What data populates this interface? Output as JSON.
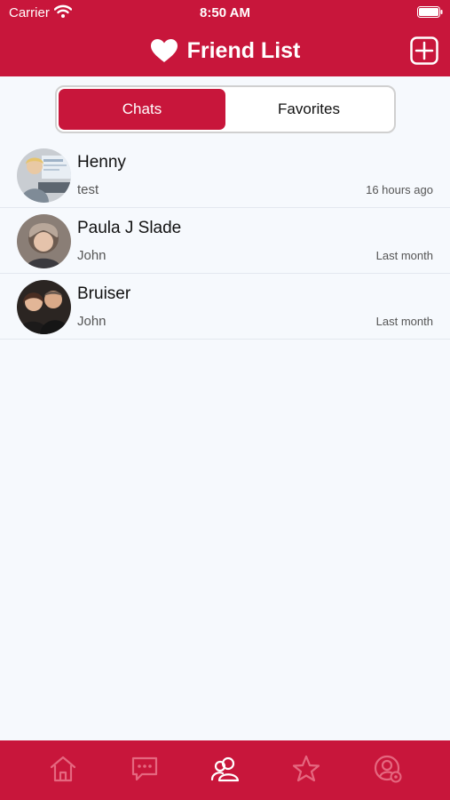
{
  "status_bar": {
    "carrier": "Carrier",
    "time": "8:50 AM"
  },
  "header": {
    "title": "Friend List",
    "icon": "heart-icon",
    "add_icon": "add-square-icon"
  },
  "segment": {
    "chats_label": "Chats",
    "favorites_label": "Favorites",
    "selected": "Chats"
  },
  "friends": [
    {
      "name": "Henny",
      "message": "test",
      "time": "16 hours ago"
    },
    {
      "name": "Paula J Slade",
      "message": "John",
      "time": "Last month"
    },
    {
      "name": "Bruiser",
      "message": "John",
      "time": "Last month"
    }
  ],
  "tabbar": {
    "icons": [
      "home-icon",
      "chat-bubble-icon",
      "friends-icon",
      "star-icon",
      "profile-settings-icon"
    ],
    "active": "friends-icon"
  },
  "colors": {
    "brand": "#c8163b",
    "background": "#f6f9fd",
    "tab_inactive": "#e5677f",
    "tab_active": "#ffffff"
  }
}
